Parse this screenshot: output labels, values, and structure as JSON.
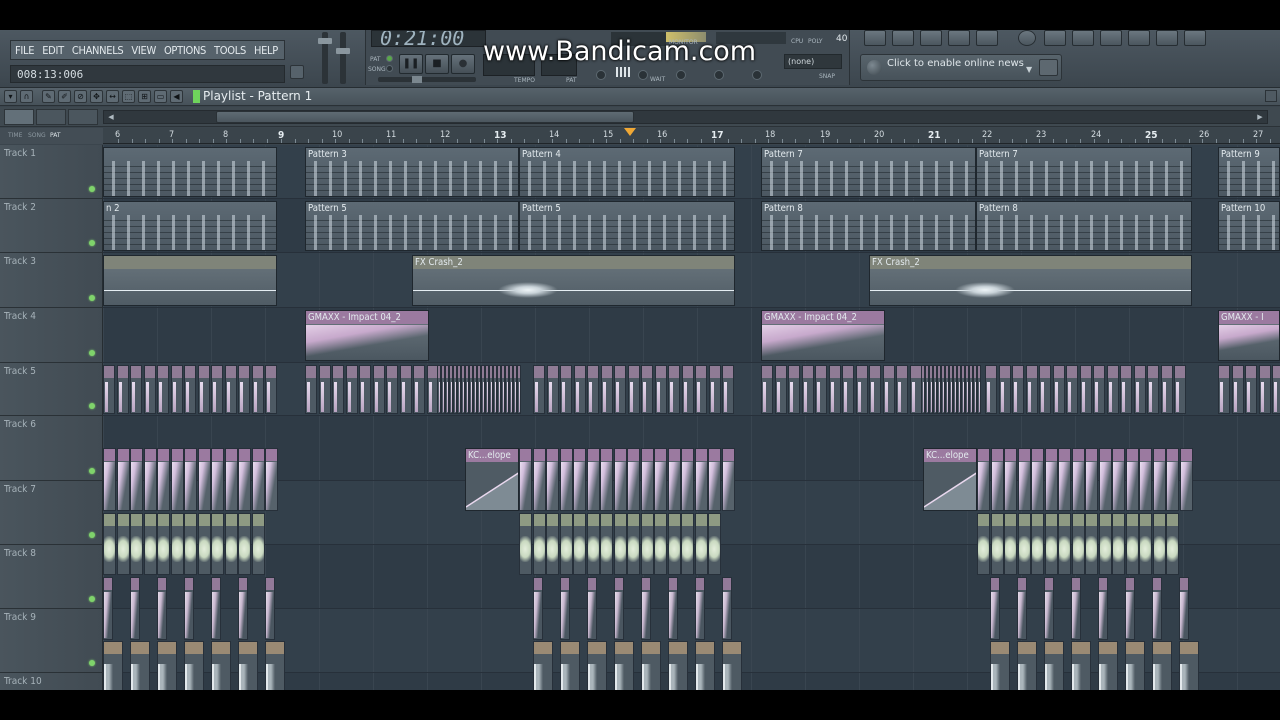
{
  "menu": [
    "FILE",
    "EDIT",
    "CHANNELS",
    "VIEW",
    "OPTIONS",
    "TOOLS",
    "HELP"
  ],
  "time_display": "008:13:006",
  "transport": {
    "lcd": "0:21:00",
    "pat_label": "PAT",
    "song_label": "SONG",
    "tempo_label": "TEMPO",
    "pat_small_label": "PAT",
    "cpu_label": "CPU",
    "poly_label": "POLY",
    "poly_value": "40",
    "monitor_label": "MONITOR",
    "none_label": "(none)",
    "wait_label": "WAIT",
    "snap_label": "SNAP"
  },
  "watermark": "www.Bandicam.com",
  "news": {
    "text": "Click to enable online news"
  },
  "playlist": {
    "title": "Playlist - Pattern 1",
    "ruler_tabs": [
      "TIME",
      "SONG",
      "PAT"
    ],
    "bars": [
      "6",
      "7",
      "8",
      "9",
      "10",
      "11",
      "12",
      "13",
      "14",
      "15",
      "16",
      "17",
      "18",
      "19",
      "20",
      "21",
      "22",
      "23",
      "24",
      "25",
      "26",
      "27"
    ],
    "tracks": [
      "Track 1",
      "Track 2",
      "Track 3",
      "Track 4",
      "Track 5",
      "Track 6",
      "Track 7",
      "Track 8",
      "Track 9",
      "Track 10"
    ],
    "clip_labels": {
      "t1": [
        "Pattern 3",
        "Pattern 4",
        "Pattern 7",
        "Pattern 7",
        "Pattern 9"
      ],
      "t2": [
        "n 2",
        "Pattern 5",
        "Pattern 5",
        "Pattern 8",
        "Pattern 8",
        "Pattern 10"
      ],
      "t3": [
        "FX Crash_2",
        "FX Crash_2"
      ],
      "t4": [
        "GMAXX - Impact 04_2",
        "GMAXX - Impact 04_2",
        "GMAXX - I"
      ],
      "t6": [
        "KC...elope",
        "KC...elope"
      ]
    }
  },
  "colors": {
    "accent_green": "#6fd35c",
    "song_position": "#f0a835",
    "impact_purple": "#9b7aa0",
    "drum_lavender": "#d8c6e2",
    "vocal_green": "#c9d9c0",
    "clip_tan": "#9a8a74"
  }
}
